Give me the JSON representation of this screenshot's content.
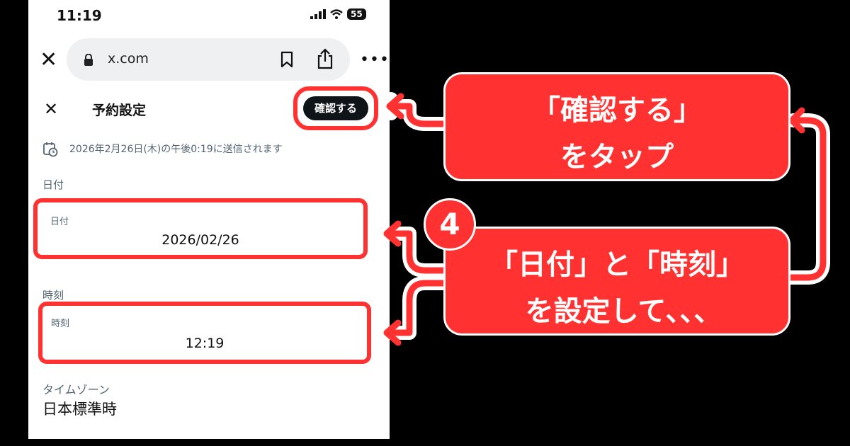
{
  "status_bar": {
    "time": "11:19",
    "battery": "55"
  },
  "browser": {
    "url": "x.com"
  },
  "sheet": {
    "title": "予約設定",
    "confirm_label": "確認する",
    "scheduled_text": "2026年2月26日(木)の午後0:19に送信されます",
    "date_section": "日付",
    "date_field_label": "日付",
    "date_value": "2026/02/26",
    "time_section": "時刻",
    "time_field_label": "時刻",
    "time_value": "12:19",
    "timezone_label": "タイムゾーン",
    "timezone_value": "日本標準時"
  },
  "annotations": {
    "top_line1": "「確認する」",
    "top_line2": "をタップ",
    "step_number": "4",
    "bottom_line1": "「日付」と「時刻」",
    "bottom_line2": "を設定して､､､"
  },
  "colors": {
    "highlight": "#ff3131",
    "button_bg": "#0f1419",
    "background": "#000000"
  },
  "icons": [
    "signal-icon",
    "wifi-icon",
    "lock-icon",
    "bookmark-icon",
    "share-icon",
    "more-icon",
    "close-icon",
    "calendar-clock-icon",
    "arrow-left-icon"
  ]
}
